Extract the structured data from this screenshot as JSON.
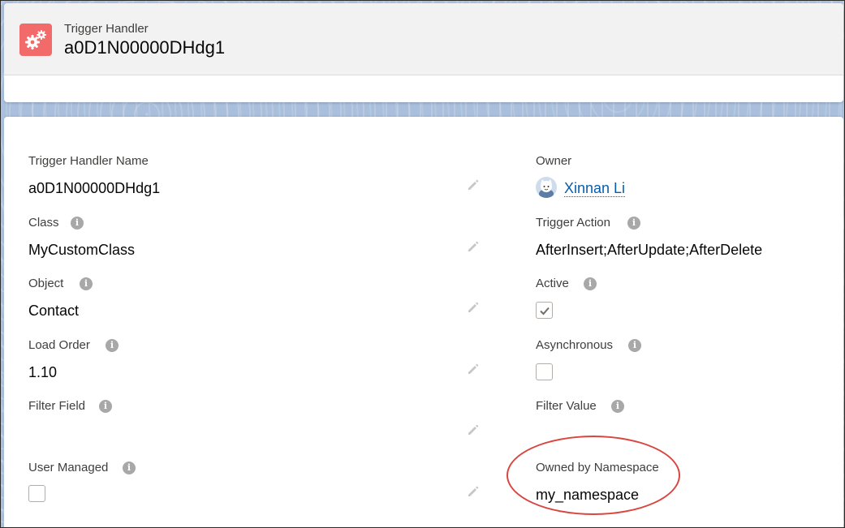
{
  "header": {
    "object_type": "Trigger Handler",
    "record_name": "a0D1N00000DHdg1"
  },
  "fields": {
    "name": {
      "label": "Trigger Handler Name",
      "value": "a0D1N00000DHdg1"
    },
    "owner": {
      "label": "Owner",
      "value": "Xinnan Li"
    },
    "class": {
      "label": "Class",
      "value": "MyCustomClass"
    },
    "trigger_action": {
      "label": "Trigger Action",
      "value": "AfterInsert;AfterUpdate;AfterDelete"
    },
    "object": {
      "label": "Object",
      "value": "Contact"
    },
    "active": {
      "label": "Active",
      "checked": true
    },
    "load_order": {
      "label": "Load Order",
      "value": "1.10"
    },
    "asynchronous": {
      "label": "Asynchronous",
      "checked": false
    },
    "filter_field": {
      "label": "Filter Field",
      "value": ""
    },
    "filter_value": {
      "label": "Filter Value",
      "value": ""
    },
    "user_managed": {
      "label": "User Managed",
      "checked": false
    },
    "owned_by_namespace": {
      "label": "Owned by Namespace",
      "value": "my_namespace"
    }
  },
  "icons": {
    "object_icon": "gears-icon",
    "info": "info-icon",
    "edit": "pencil-icon",
    "check": "check-icon"
  },
  "colors": {
    "object_icon_bg": "#f26a6a",
    "link": "#0a5dab",
    "highlight_oval": "#d9453f"
  }
}
